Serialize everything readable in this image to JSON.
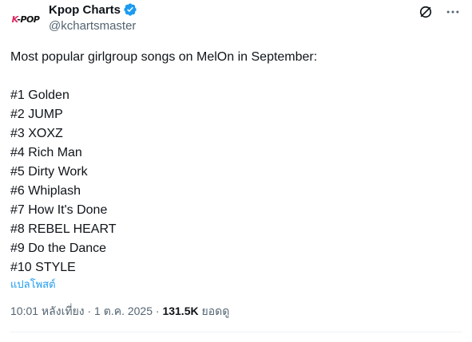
{
  "author": {
    "display_name": "Kpop Charts",
    "handle": "@kchartsmaster",
    "avatar_text_k": "K",
    "avatar_text_rest": "-POP",
    "verified_icon": "verified-badge-icon",
    "verified_color": "#1d9bf0"
  },
  "actions": {
    "grok_icon": "grok-icon",
    "more_icon": "more-dots-icon"
  },
  "tweet": {
    "intro": "Most popular girlgroup songs on MelOn in September:",
    "list": [
      "#1 Golden",
      "#2 JUMP",
      "#3 XOXZ",
      "#4 Rich Man",
      "#5 Dirty Work",
      "#6 Whiplash",
      "#7 How It's Done",
      "#8 REBEL HEART",
      "#9 Do the Dance",
      "#10 STYLE"
    ]
  },
  "translate_label": "แปลโพสต์",
  "meta": {
    "time_date": "10:01 หลังเที่ยง · 1 ต.ค. 2025 · ",
    "views_count": "131.5K",
    "views_label": " ยอดดู"
  },
  "colors": {
    "text": "#0f1419",
    "secondary": "#536471",
    "accent": "#1d9bf0",
    "divider": "#eff3f4"
  }
}
